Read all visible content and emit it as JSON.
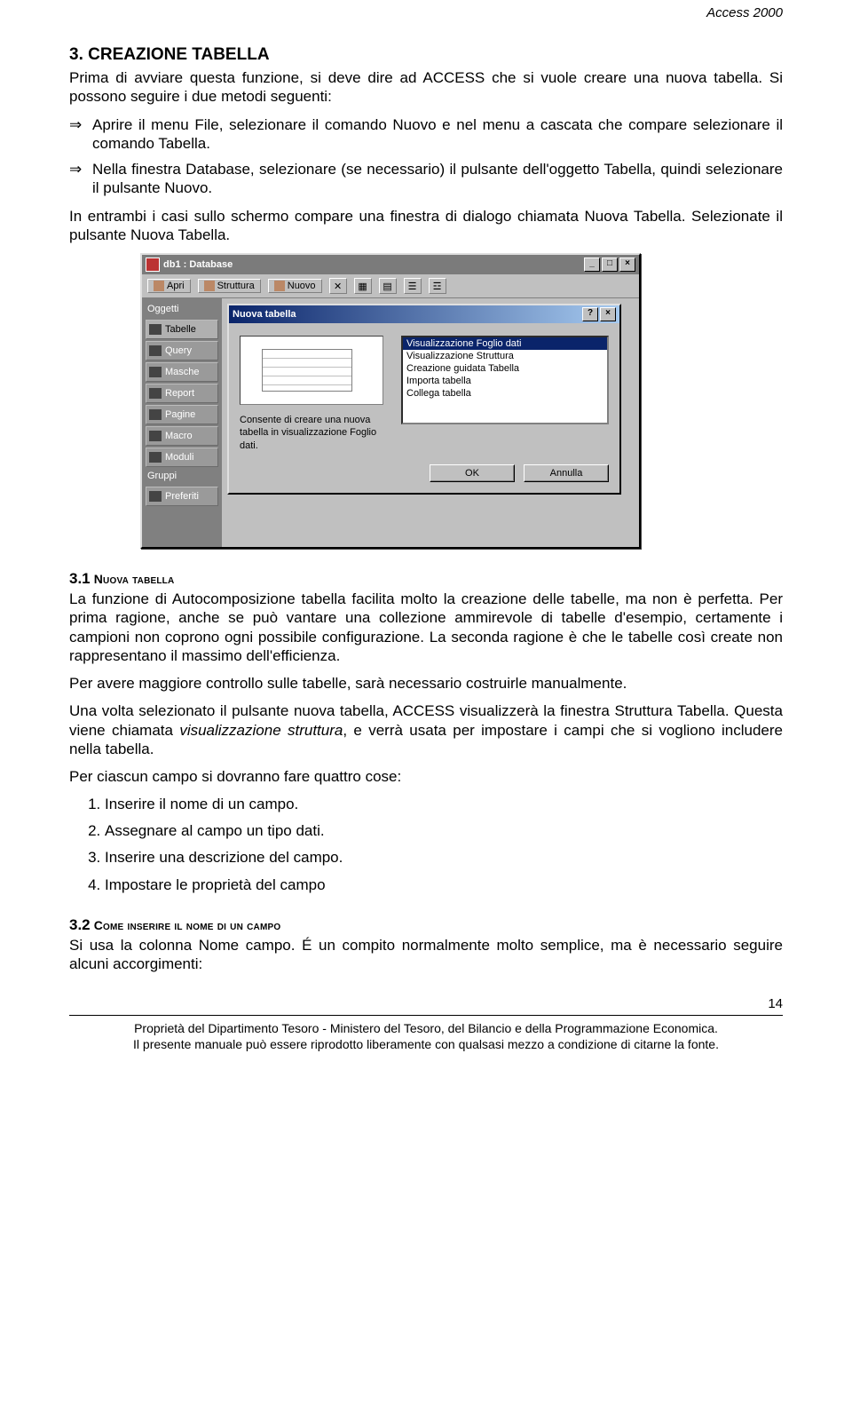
{
  "header": {
    "doc_title": "Access 2000"
  },
  "section3": {
    "heading": "3.  CREAZIONE TABELLA",
    "intro": "Prima di avviare questa funzione, si deve dire ad ACCESS che si vuole creare una nuova tabella. Si possono seguire i due metodi seguenti:",
    "bullet1": "Aprire il menu File, selezionare il comando Nuovo e nel menu a cascata che compare selezionare il comando Tabella.",
    "bullet2": "Nella finestra Database, selezionare (se necessario) il pulsante dell'oggetto Tabella, quindi selezionare il pulsante Nuovo.",
    "after": "In entrambi i casi sullo schermo compare una finestra di dialogo chiamata Nuova Tabella. Selezionate il pulsante Nuova Tabella."
  },
  "shot": {
    "db_title": "db1 : Database",
    "tb_apri": "Apri",
    "tb_struttura": "Struttura",
    "tb_nuovo": "Nuovo",
    "sb_label_oggetti": "Oggetti",
    "sb_items": [
      "Tabelle",
      "Query",
      "Masche",
      "Report",
      "Pagine",
      "Macro",
      "Moduli"
    ],
    "sb_label_gruppi": "Gruppi",
    "sb_pref": "Preferiti",
    "dlg_title": "Nuova tabella",
    "dlg_desc": "Consente di creare una nuova tabella in visualizzazione Foglio dati.",
    "dlg_options": [
      "Visualizzazione Foglio dati",
      "Visualizzazione Struttura",
      "Creazione guidata Tabella",
      "Importa tabella",
      "Collega tabella"
    ],
    "btn_ok": "OK",
    "btn_cancel": "Annulla"
  },
  "section31": {
    "heading_num": "3.1",
    "heading_caps": "  Nuova tabella",
    "p1": "La funzione di Autocomposizione tabella facilita molto la creazione delle tabelle, ma non è perfetta. Per prima ragione, anche se può vantare una collezione ammirevole di tabelle d'esempio, certamente i campioni non coprono ogni possibile configurazione. La seconda ragione è che le tabelle così  create non rappresentano il massimo dell'efficienza.",
    "p2": "Per avere maggiore controllo sulle tabelle, sarà necessario costruirle manualmente.",
    "p3a": "Una volta selezionato il pulsante nuova tabella, ACCESS visualizzerà la finestra Struttura Tabella. Questa viene chiamata ",
    "p3i": "visualizzazione struttura",
    "p3b": ", e verrà usata per impostare i campi che si vogliono includere nella tabella.",
    "p4": "Per ciascun campo si dovranno fare quattro cose:",
    "steps": [
      "Inserire il nome di un campo.",
      "Assegnare al campo un tipo dati.",
      "Inserire una descrizione del campo.",
      "Impostare le proprietà del campo"
    ]
  },
  "section32": {
    "heading_num": "3.2",
    "heading_caps": "  Come inserire il nome di un campo",
    "p1": "Si usa la colonna Nome campo. É un compito normalmente molto semplice, ma è necessario seguire alcuni accorgimenti:"
  },
  "footer": {
    "pagenum": "14",
    "line1": "Proprietà del Dipartimento Tesoro - Ministero del Tesoro, del Bilancio e della Programmazione Economica.",
    "line2": "Il presente manuale può essere riprodotto liberamente con qualsasi mezzo a condizione di citarne la fonte."
  }
}
